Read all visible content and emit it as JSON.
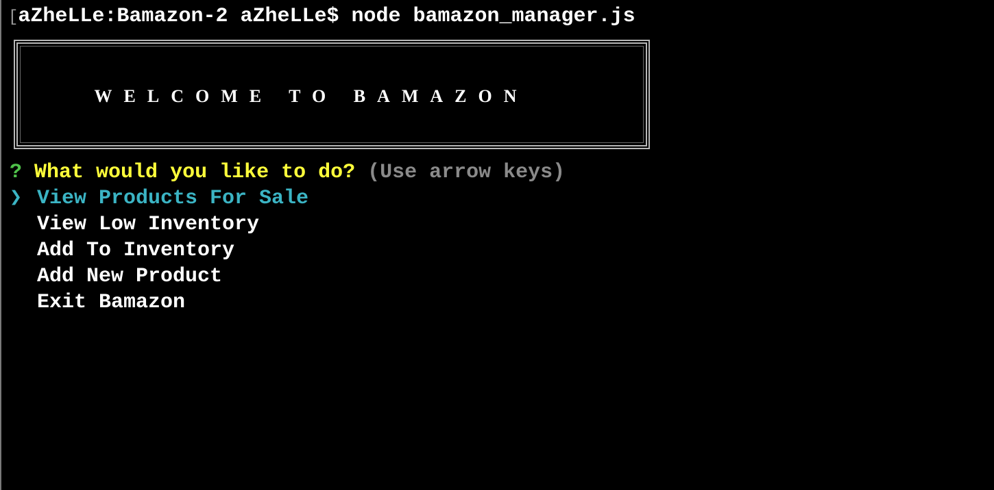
{
  "terminal": {
    "prompt": "aZheLLe:Bamazon-2 aZheLLe$ ",
    "command": "node bamazon_manager.js",
    "cursor_bracket": "["
  },
  "banner": {
    "title": "WELCOME TO BAMAZON"
  },
  "question": {
    "marker": "?",
    "text": "What would you like to do?",
    "hint": "(Use arrow keys)"
  },
  "menu": {
    "pointer": "❯",
    "items": [
      {
        "label": "View Products For Sale",
        "selected": true
      },
      {
        "label": "View Low Inventory",
        "selected": false
      },
      {
        "label": "Add To Inventory",
        "selected": false
      },
      {
        "label": "Add New Product",
        "selected": false
      },
      {
        "label": "Exit Bamazon",
        "selected": false
      }
    ]
  },
  "colors": {
    "background": "#000000",
    "question": "#ffff3a",
    "marker": "#4fc14a",
    "selected": "#3bb4c4",
    "hint": "#8a8a8a"
  }
}
